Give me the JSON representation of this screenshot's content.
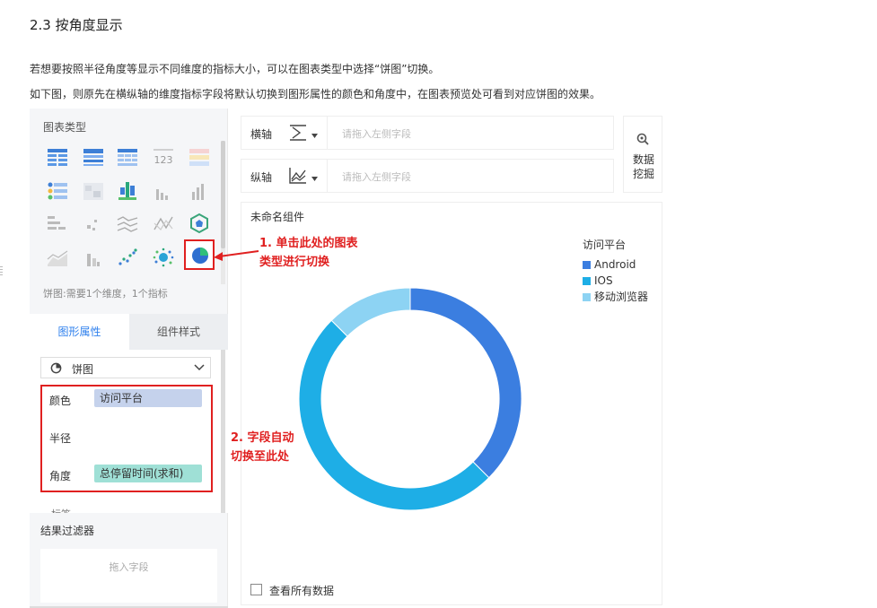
{
  "doc": {
    "section_title": "2.3 按角度显示",
    "para1": "若想要按照半径角度等显示不同维度的指标大小，可以在图表类型中选择“饼图”切换。",
    "para2": "如下图，则原先在横纵轴的维度指标字段将默认切换到图形属性的颜色和角度中，在图表预览处可看到对应饼图的效果。"
  },
  "left_panel": {
    "title": "图表类型",
    "hint": "饼图:需要1个维度，1个指标",
    "chart_icons": [
      "table-icon",
      "cross-table-icon",
      "detail-table-icon",
      "kpi-number-icon",
      "color-table-icon",
      "indicator-card-icon",
      "heatmap-icon",
      "bar-cluster-icon",
      "small-bar-icon",
      "column-icon",
      "range-bar-icon",
      "scatter-small-icon",
      "multi-line-icon",
      "radar-line-icon",
      "hexagon-icon",
      "area-icon",
      "stacked-bar-icon",
      "dot-plot-icon",
      "bubble-icon",
      "pie-icon"
    ],
    "tabs": {
      "graph_props": "图形属性",
      "component_style": "组件样式"
    },
    "select_value": "饼图",
    "fields": {
      "color_label": "颜色",
      "color_value": "访问平台",
      "radius_label": "半径",
      "angle_label": "角度",
      "angle_value": "总停留时间(求和)",
      "tag_label": "标签"
    },
    "filter_title": "结果过滤器",
    "filter_placeholder": "拖入字段"
  },
  "axes": {
    "x_label": "横轴",
    "y_label": "纵轴",
    "x_placeholder": "请拖入左侧字段",
    "y_placeholder": "请拖入左侧字段",
    "mine_label_line1": "数据",
    "mine_label_line2": "挖掘"
  },
  "chart_panel": {
    "component_name": "未命名组件",
    "show_all_label": "查看所有数据"
  },
  "annotations": {
    "a1_line1": "1. 单击此处的图表",
    "a1_line2": "类型进行切换",
    "a2_line1": "2. 字段自动",
    "a2_line2": "切换至此处"
  },
  "chart_data": {
    "type": "pie",
    "legend_title": "访问平台",
    "categories": [
      "Android",
      "IOS",
      "移动浏览器"
    ],
    "values": [
      37.5,
      50,
      12.5
    ],
    "colors": [
      "#3b7ee0",
      "#1eaee6",
      "#8dd3f3"
    ],
    "legend_position": "top-right"
  }
}
